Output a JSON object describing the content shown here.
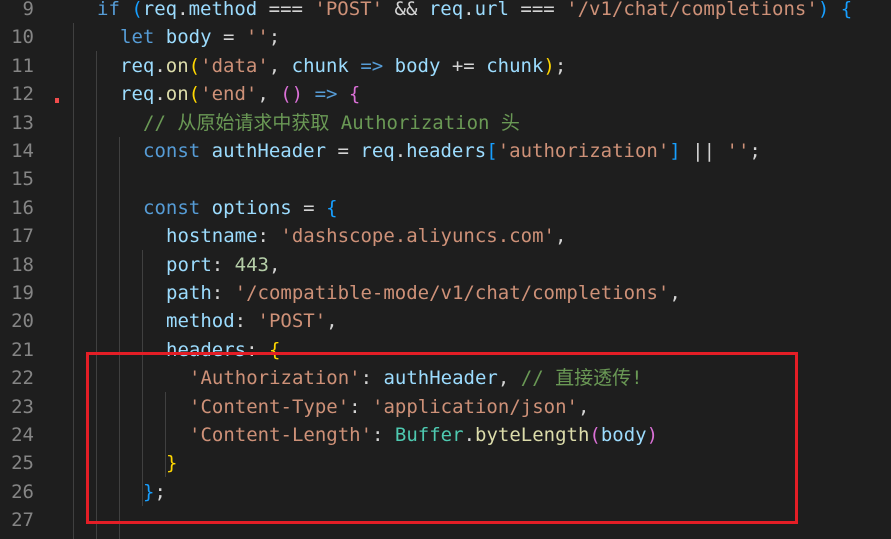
{
  "editor": {
    "line_numbers": [
      "9",
      "10",
      "11",
      "12",
      "13",
      "14",
      "15",
      "16",
      "17",
      "18",
      "19",
      "20",
      "21",
      "22",
      "23",
      "24",
      "25",
      "26",
      "27"
    ],
    "lines": [
      [
        {
          "t": "if",
          "c": "kw"
        },
        {
          "t": " ",
          "c": "op"
        },
        {
          "t": "(",
          "c": "b3"
        },
        {
          "t": "req",
          "c": "var"
        },
        {
          "t": ".",
          "c": "op"
        },
        {
          "t": "method",
          "c": "var"
        },
        {
          "t": " === ",
          "c": "op"
        },
        {
          "t": "'POST'",
          "c": "str"
        },
        {
          "t": " && ",
          "c": "op"
        },
        {
          "t": "req",
          "c": "var"
        },
        {
          "t": ".",
          "c": "op"
        },
        {
          "t": "url",
          "c": "var"
        },
        {
          "t": " === ",
          "c": "op"
        },
        {
          "t": "'/v1/chat/completions'",
          "c": "str"
        },
        {
          "t": ")",
          "c": "b3"
        },
        {
          "t": " ",
          "c": "op"
        },
        {
          "t": "{",
          "c": "b3"
        }
      ],
      [
        {
          "t": "let",
          "c": "kw"
        },
        {
          "t": " ",
          "c": "op"
        },
        {
          "t": "body",
          "c": "var"
        },
        {
          "t": " = ",
          "c": "op"
        },
        {
          "t": "''",
          "c": "str"
        },
        {
          "t": ";",
          "c": "op"
        }
      ],
      [
        {
          "t": "req",
          "c": "var"
        },
        {
          "t": ".",
          "c": "op"
        },
        {
          "t": "on",
          "c": "fn"
        },
        {
          "t": "(",
          "c": "b1"
        },
        {
          "t": "'data'",
          "c": "str"
        },
        {
          "t": ", ",
          "c": "op"
        },
        {
          "t": "chunk",
          "c": "var"
        },
        {
          "t": " ",
          "c": "op"
        },
        {
          "t": "=>",
          "c": "kw"
        },
        {
          "t": " ",
          "c": "op"
        },
        {
          "t": "body",
          "c": "var"
        },
        {
          "t": " += ",
          "c": "op"
        },
        {
          "t": "chunk",
          "c": "var"
        },
        {
          "t": ")",
          "c": "b1"
        },
        {
          "t": ";",
          "c": "op"
        }
      ],
      [
        {
          "t": "req",
          "c": "var"
        },
        {
          "t": ".",
          "c": "op"
        },
        {
          "t": "on",
          "c": "fn"
        },
        {
          "t": "(",
          "c": "b1"
        },
        {
          "t": "'end'",
          "c": "str"
        },
        {
          "t": ", ",
          "c": "op"
        },
        {
          "t": "()",
          "c": "b2"
        },
        {
          "t": " ",
          "c": "op"
        },
        {
          "t": "=>",
          "c": "kw"
        },
        {
          "t": " ",
          "c": "op"
        },
        {
          "t": "{",
          "c": "b2"
        }
      ],
      [
        {
          "t": "// 从原始请求中获取 Authorization 头",
          "c": "cmt"
        }
      ],
      [
        {
          "t": "const",
          "c": "kw"
        },
        {
          "t": " ",
          "c": "op"
        },
        {
          "t": "authHeader",
          "c": "var"
        },
        {
          "t": " = ",
          "c": "op"
        },
        {
          "t": "req",
          "c": "var"
        },
        {
          "t": ".",
          "c": "op"
        },
        {
          "t": "headers",
          "c": "var"
        },
        {
          "t": "[",
          "c": "b3"
        },
        {
          "t": "'authorization'",
          "c": "str"
        },
        {
          "t": "]",
          "c": "b3"
        },
        {
          "t": " || ",
          "c": "op"
        },
        {
          "t": "''",
          "c": "str"
        },
        {
          "t": ";",
          "c": "op"
        }
      ],
      [],
      [
        {
          "t": "const",
          "c": "kw"
        },
        {
          "t": " ",
          "c": "op"
        },
        {
          "t": "options",
          "c": "var"
        },
        {
          "t": " = ",
          "c": "op"
        },
        {
          "t": "{",
          "c": "b3"
        }
      ],
      [
        {
          "t": "hostname",
          "c": "var"
        },
        {
          "t": ": ",
          "c": "op"
        },
        {
          "t": "'dashscope.aliyuncs.com'",
          "c": "str"
        },
        {
          "t": ",",
          "c": "op"
        }
      ],
      [
        {
          "t": "port",
          "c": "var"
        },
        {
          "t": ": ",
          "c": "op"
        },
        {
          "t": "443",
          "c": "num"
        },
        {
          "t": ",",
          "c": "op"
        }
      ],
      [
        {
          "t": "path",
          "c": "var"
        },
        {
          "t": ": ",
          "c": "op"
        },
        {
          "t": "'/compatible-mode/v1/chat/completions'",
          "c": "str"
        },
        {
          "t": ",",
          "c": "op"
        }
      ],
      [
        {
          "t": "method",
          "c": "var"
        },
        {
          "t": ": ",
          "c": "op"
        },
        {
          "t": "'POST'",
          "c": "str"
        },
        {
          "t": ",",
          "c": "op"
        }
      ],
      [
        {
          "t": "headers",
          "c": "var"
        },
        {
          "t": ": ",
          "c": "op"
        },
        {
          "t": "{",
          "c": "b1"
        }
      ],
      [
        {
          "t": "'Authorization'",
          "c": "str"
        },
        {
          "t": ": ",
          "c": "op"
        },
        {
          "t": "authHeader",
          "c": "var"
        },
        {
          "t": ", ",
          "c": "op"
        },
        {
          "t": "// 直接透传!",
          "c": "cmt"
        }
      ],
      [
        {
          "t": "'Content-Type'",
          "c": "str"
        },
        {
          "t": ": ",
          "c": "op"
        },
        {
          "t": "'application/json'",
          "c": "str"
        },
        {
          "t": ",",
          "c": "op"
        }
      ],
      [
        {
          "t": "'Content-Length'",
          "c": "str"
        },
        {
          "t": ": ",
          "c": "op"
        },
        {
          "t": "Buffer",
          "c": "cls"
        },
        {
          "t": ".",
          "c": "op"
        },
        {
          "t": "byteLength",
          "c": "fn"
        },
        {
          "t": "(",
          "c": "b2"
        },
        {
          "t": "body",
          "c": "var"
        },
        {
          "t": ")",
          "c": "b2"
        }
      ],
      [
        {
          "t": "}",
          "c": "b1"
        }
      ],
      [
        {
          "t": "}",
          "c": "b3"
        },
        {
          "t": ";",
          "c": "op"
        }
      ],
      []
    ]
  },
  "colors": {
    "background": "#1e1e1e",
    "line_number": "#858585",
    "highlight_border": "#e41e26",
    "modified_marker": "#f14c4c"
  }
}
